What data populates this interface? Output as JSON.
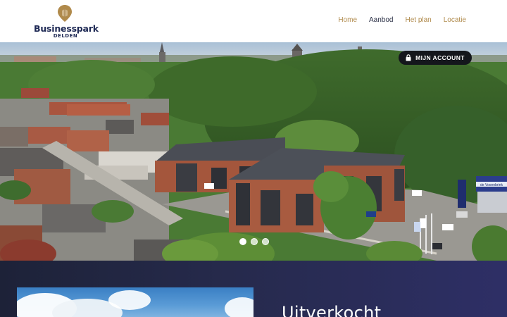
{
  "brand": {
    "name": "Businesspark",
    "sub": "DELDEN",
    "accent": "#b08a4b",
    "navy": "#1f2a55"
  },
  "nav": {
    "items": [
      {
        "label": "Home",
        "active": false
      },
      {
        "label": "Aanbod",
        "active": true
      },
      {
        "label": "Het plan",
        "active": false
      },
      {
        "label": "Locatie",
        "active": false
      }
    ]
  },
  "hero": {
    "account_label": "MIJN ACCOUNT",
    "account_icon": "lock-icon",
    "slides": 3,
    "active_slide": 1,
    "sign_text": "de Vooenbrink"
  },
  "section": {
    "title": "Uitverkocht"
  }
}
